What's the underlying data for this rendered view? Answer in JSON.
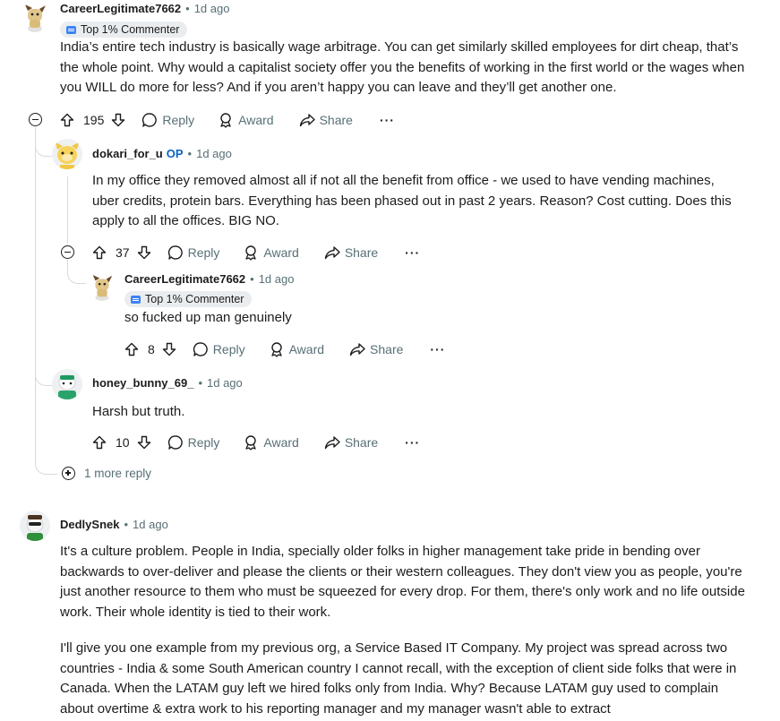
{
  "comments": [
    {
      "username": "CareerLegitimate7662",
      "time": "1d ago",
      "badge": "Top 1% Commenter",
      "body": "India’s entire tech industry is basically wage arbitrage. You can get similarly skilled employees for dirt cheap, that’s the whole point. Why would a capitalist society offer you the benefits of working in the first world or the wages when you WILL do more for less? And if you aren’t happy you can leave and they’ll get another one.",
      "votes": "195",
      "reply_label": "Reply",
      "award_label": "Award",
      "share_label": "Share",
      "more_label": "···"
    },
    {
      "username": "dokari_for_u",
      "op_label": "OP",
      "time": "1d ago",
      "body": "In my office they removed almost all if not all the benefit from office - we used to have vending machines, uber credits, protein bars. Everything has been phased out in past 2 years. Reason? Cost cutting. Does this apply to all the offices. BIG NO.",
      "votes": "37",
      "reply_label": "Reply",
      "award_label": "Award",
      "share_label": "Share",
      "more_label": "···"
    },
    {
      "username": "CareerLegitimate7662",
      "time": "1d ago",
      "badge": "Top 1% Commenter",
      "body": "so fucked up man genuinely",
      "votes": "8",
      "reply_label": "Reply",
      "award_label": "Award",
      "share_label": "Share",
      "more_label": "···"
    },
    {
      "username": "honey_bunny_69_",
      "time": "1d ago",
      "body": "Harsh but truth.",
      "votes": "10",
      "reply_label": "Reply",
      "award_label": "Award",
      "share_label": "Share",
      "more_label": "···"
    },
    {
      "username": "DedlySnek",
      "time": "1d ago",
      "body": "It's a culture problem. People in India, specially older folks in higher management take pride in bending over backwards to over-deliver and please the clients or their western colleagues. They don't view you as people, you're just another resource to them who must be squeezed for every drop. For them, there's only work and no life outside work. Their whole identity is tied to their work.",
      "body2": "I'll give you one example from my previous org, a Service Based IT Company. My project was spread across two countries - India & some South American country I cannot recall, with the exception of client side folks that were in Canada. When the LATAM guy left we hired folks only from India. Why? Because LATAM guy used to complain about overtime & extra work to his reporting manager and my manager wasn't able to extract"
    }
  ],
  "more_replies": "1 more reply",
  "colors": {
    "text": "#1c1c1c",
    "muted": "#576f76",
    "op": "#0a63c7",
    "badge_bg": "#eaedef",
    "thread_line": "#d7dadc"
  }
}
